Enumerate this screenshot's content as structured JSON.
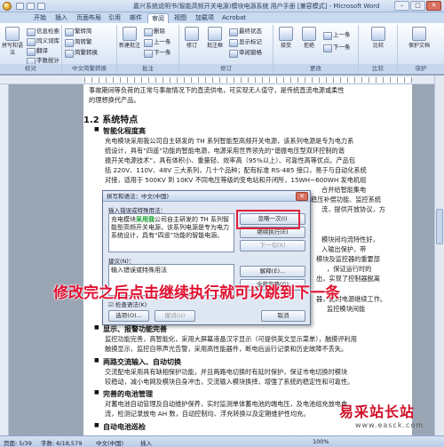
{
  "window": {
    "title": "嘉兴系统说明书(智能高频开关电源)模块电源系统 用户手册 [兼容模式] - Microsoft Word",
    "min": "–",
    "max": "□",
    "close": "✕"
  },
  "tabs": [
    {
      "label": "开始"
    },
    {
      "label": "插入"
    },
    {
      "label": "页面布局"
    },
    {
      "label": "引用"
    },
    {
      "label": "邮件"
    },
    {
      "label": "审阅"
    },
    {
      "label": "视图"
    },
    {
      "label": "加载项"
    },
    {
      "label": "Acrobat"
    }
  ],
  "ribbon": {
    "proof": {
      "label": "校对",
      "spell": "拼写和语法",
      "research": "信息检索",
      "thesaurus": "同义词库",
      "translate": "翻译",
      "wordcount": "字数统计"
    },
    "chinese": {
      "label": "中文简繁转换",
      "t2s": "繁转简",
      "s2t": "简转繁",
      "convert": "简繁转换"
    },
    "comments": {
      "label": "批注",
      "new": "新建批注",
      "delete": "删除",
      "prev": "上一条",
      "next": "下一条"
    },
    "tracking": {
      "label": "修订",
      "track": "修订",
      "balloons": "批注框",
      "final": "最终状态",
      "show": "显示标记",
      "pane": "审阅窗格"
    },
    "changes": {
      "label": "更改",
      "accept": "接受",
      "reject": "拒绝",
      "prev": "上一条",
      "next": "下一条"
    },
    "compare": {
      "label": "比较",
      "btn": "比较"
    },
    "protect": {
      "label": "保护",
      "btn": "保护文档"
    }
  },
  "doc": {
    "line0": "事故期间等负荷的正常与事故情况下的直流供电，可实现无人值守，是传统直流电源或柔性",
    "line1": "的理想换代产品。",
    "heading": "1.2 系统特点",
    "sub1": "智能化程度高",
    "p1a": "充电模块采用我公司自主研发的 TH 系列智能型高频开关电源，该系列电源是专为电力系",
    "p1b": "统设计，具有“四遥”功能的智能电源，电源采用世界领先的“谐振电压型双环控制的谐",
    "p1c": "振开关电源技术”，具有体积小、重量轻、效率高（95%以上）、可靠性高等优点。产品包",
    "p1d": "括 220V、110V、48V 三大系列，几十个品种；配有标准 RS-485 接口，易于与自动化系统",
    "p1e": "对接，适用于 500KV 到 10KV 不同电压等级的变电站和开闭所，15WH~600WH 发电机组",
    "r1": "合并给智能集电",
    "r2": "稳压补偿功能、监控系统",
    "r3": "流，提供开放协议，方",
    "r4": "模块间均流特性好，",
    "r5": "入输出保护，带",
    "r6": "模块及监控器的重要部",
    "r7": "，保证运行时的",
    "r8": "出，实现了控制器脱离",
    "r9": "器，此时电源继续工作。",
    "r10": "监控模块间能",
    "sub2": "显示、报警功能完善",
    "p2a": "监控功能完善，高智能化，采用大屏幕液晶汉字显示（可提供英文显示菜单），触摸评利用",
    "p2b": "触摸显示，监控自带声光告警，采用高性能器件，断电后运行记录和历史故障不丢失。",
    "sub3": "两路交流输入、自动切换",
    "p3a": "交流配电采用具有缺相保护功能，并且两路电切换时有延时保护，保证市电切换时模块",
    "p3b": "较稳动，减小电网及模块自身冲击，交流输入模块换择，增强了系统的稳定性和可靠性。",
    "sub4": "完善的电池管理",
    "p4a": "对蓄电池自动管理及自动维护保养，实时监测单体蓄电池的端电压，及电池组充放电电",
    "p4b": "流，检测记录放电 AH 数，自动控制均、浮充转换以及定期维护性均充。",
    "sub5": "自动电池巡检"
  },
  "dialog": {
    "title": "拼写和语法：中文(中国)",
    "close": "✕",
    "input_label": "输入错误或特殊用法：",
    "sentence_pre": "充电模块",
    "sentence_mark": "采用我",
    "sentence_post": "公司自主研发的 TH 系列智能型高频开关电源，该系列电源是专为电力系统设计，具有“四遥”功能的智能电源。",
    "suggest_label": "建议(N)：",
    "suggest_value": "输入错误或特殊用法",
    "checkbox": "检查语法(K)",
    "btn_ignore": "忽略一次(I)",
    "btn_ignore_rule": "全部忽略(G)",
    "btn_resume": "继续执行(E)",
    "btn_next": "下一句(X)",
    "btn_explain": "解释(E)...",
    "btn_options": "选项(O)...",
    "btn_undo": "撤消(U)",
    "btn_cancel": "取消"
  },
  "annotation": "修改完之后点击继续执行就可以跳到下一条",
  "status": {
    "page": "页面: 5/39",
    "words": "字数: 6/18,579",
    "lang": "中文(中国)",
    "mode": "插入",
    "zoom": "100%"
  },
  "watermark": {
    "brand": "易采站长站",
    "url": "www.easck.com"
  }
}
